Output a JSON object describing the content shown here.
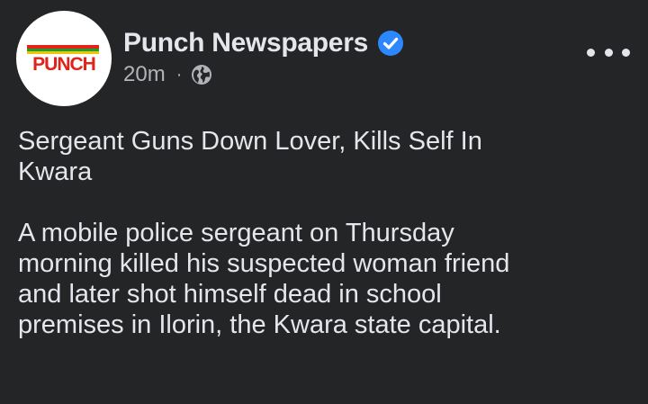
{
  "header": {
    "page_name": "Punch Newspapers",
    "logo_text": "PUNCH",
    "timestamp": "20m",
    "separator": "·",
    "audience_icon": "globe-icon",
    "verified_icon": "verified-badge-icon",
    "more_icon": "more-options-icon"
  },
  "post": {
    "headline": "Sergeant Guns Down Lover, Kills Self In\nKwara",
    "body": "A mobile police sergeant on Thursday\nmorning killed his suspected woman friend\nand later shot himself dead in school\npremises in Ilorin, the Kwara state capital."
  },
  "colors": {
    "background": "#242526",
    "primary_text": "#e4e6eb",
    "secondary_text": "#b0b3b8",
    "verified_blue": "#2d88ff",
    "logo_red": "#e2231a",
    "logo_green": "#1a9e3a",
    "logo_yellow": "#f5c400"
  }
}
